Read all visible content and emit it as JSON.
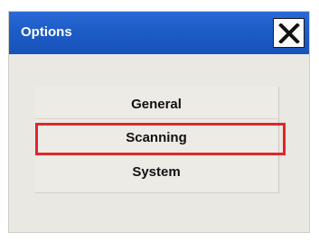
{
  "dialog": {
    "title": "Options",
    "close_icon": "close-icon",
    "titlebar_color": "#1d5cc7"
  },
  "menu": {
    "items": [
      {
        "label": "General"
      },
      {
        "label": "Scanning",
        "highlighted": true
      },
      {
        "label": "System"
      }
    ]
  },
  "highlight_color": "#e0262c"
}
